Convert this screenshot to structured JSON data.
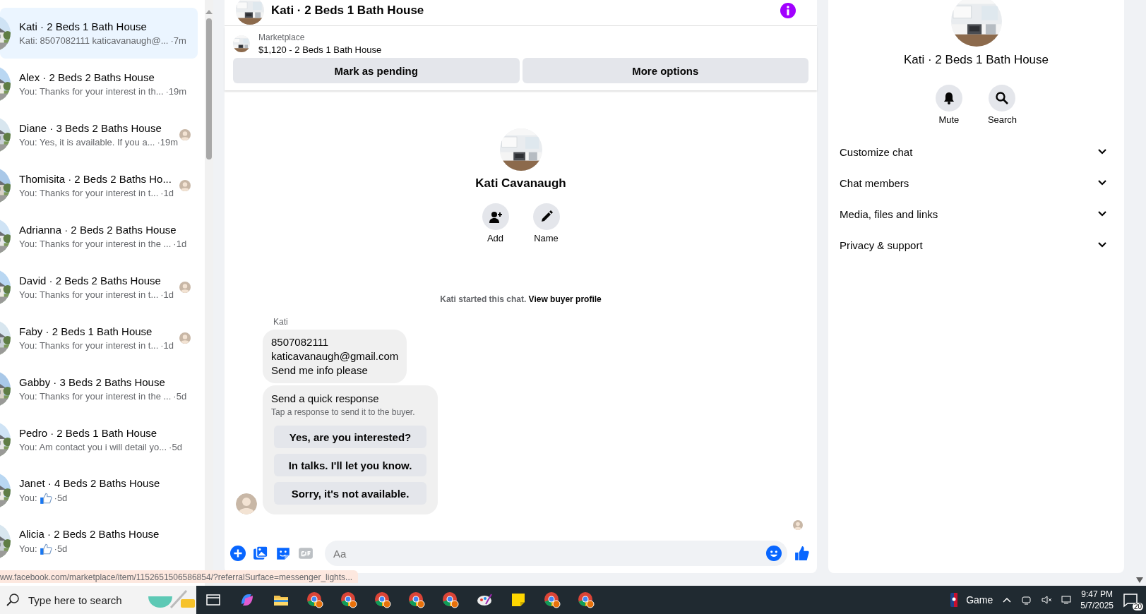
{
  "conversation_list": {
    "rows": [
      {
        "kind": "text",
        "title": "Kati · 2 Beds 1 Bath House",
        "preview": "Kati: 8507082111 katicavanaugh@...",
        "time": "·7m",
        "selected": true,
        "seen": false
      },
      {
        "kind": "text",
        "title": "Alex · 2 Beds 2 Baths House",
        "preview": "You: Thanks for your interest in th...",
        "time": "·19m",
        "selected": false,
        "seen": false
      },
      {
        "kind": "text",
        "title": "Diane · 3 Beds 2 Baths House",
        "preview": "You: Yes, it is available. If you a...",
        "time": "·19m",
        "selected": false,
        "seen": true
      },
      {
        "kind": "text",
        "title": "Thomisita · 2 Beds 2 Baths Ho...",
        "preview": "You: Thanks for your interest in t...",
        "time": "·1d",
        "selected": false,
        "seen": true
      },
      {
        "kind": "text",
        "title": "Adrianna · 2 Beds 2 Baths House",
        "preview": "You: Thanks for your interest in the ...",
        "time": "·1d",
        "selected": false,
        "seen": false
      },
      {
        "kind": "text",
        "title": "David · 2 Beds 2 Baths House",
        "preview": "You: Thanks for your interest in t...",
        "time": "·1d",
        "selected": false,
        "seen": true
      },
      {
        "kind": "text",
        "title": "Faby · 2 Beds 1 Bath House",
        "preview": "You: Thanks for your interest in t...",
        "time": "·1d",
        "selected": false,
        "seen": true
      },
      {
        "kind": "text",
        "title": "Gabby · 3 Beds 2 Baths House",
        "preview": "You: Thanks for your interest in the ...",
        "time": "·5d",
        "selected": false,
        "seen": false
      },
      {
        "kind": "text",
        "title": "Pedro · 2 Beds 1 Bath House",
        "preview": "You: Am contact you i will detail yo...",
        "time": "·5d",
        "selected": false,
        "seen": false
      },
      {
        "kind": "like",
        "title": "Janet · 4 Beds 2 Baths House",
        "preview": "You:",
        "time": "·5d",
        "selected": false,
        "seen": false
      },
      {
        "kind": "like",
        "title": "Alicia · 2 Beds 2 Baths House",
        "preview": "You:",
        "time": "·5d",
        "selected": false,
        "seen": false
      }
    ]
  },
  "chat": {
    "title": "Kati · 2 Beds 1 Bath House",
    "listing": {
      "label": "Marketplace",
      "name": "$1,120 - 2 Beds 1 Bath House"
    },
    "actions": [
      "Mark as pending",
      "More options"
    ],
    "profile": {
      "name": "Kati Cavanaugh",
      "buttons": [
        {
          "label": "Add"
        },
        {
          "label": "Name"
        }
      ]
    },
    "notice": {
      "text": "Kati started this chat.",
      "link": "View buyer profile"
    },
    "sender": "Kati",
    "message_lines": [
      "8507082111",
      "katicavanaugh@gmail.com",
      "Send me info please"
    ],
    "quick_response": {
      "title": "Send a quick response",
      "subtitle": "Tap a response to send it to the buyer.",
      "options": [
        "Yes, are you interested?",
        "In talks. I'll let you know.",
        "Sorry, it's not available."
      ]
    },
    "composer": {
      "placeholder": "Aa"
    }
  },
  "details": {
    "title": "Kati · 2 Beds 1 Bath House",
    "buttons": [
      {
        "label": "Mute"
      },
      {
        "label": "Search"
      }
    ],
    "sections": [
      {
        "label": "Customize chat",
        "expanded": false
      },
      {
        "label": "Chat members",
        "expanded": false
      },
      {
        "label": "Media, files and links",
        "expanded": false
      },
      {
        "label": "Privacy & support",
        "expanded": false
      }
    ]
  },
  "status_url": "ww.facebook.com/marketplace/item/1152651506586854/?referralSurface=messenger_lights...",
  "taskbar": {
    "search_placeholder": "Type here to search",
    "apps": [
      {
        "kind": "taskview"
      },
      {
        "kind": "copilot"
      },
      {
        "kind": "explorer"
      },
      {
        "kind": "chrome"
      },
      {
        "kind": "chrome"
      },
      {
        "kind": "chrome"
      },
      {
        "kind": "chrome"
      },
      {
        "kind": "chrome"
      },
      {
        "kind": "paint"
      },
      {
        "kind": "sticky"
      },
      {
        "kind": "chrome"
      },
      {
        "kind": "chrome"
      }
    ],
    "tray": {
      "game": "Game",
      "time": "9:47 PM",
      "date": "5/7/2025",
      "notifications": "20"
    }
  }
}
